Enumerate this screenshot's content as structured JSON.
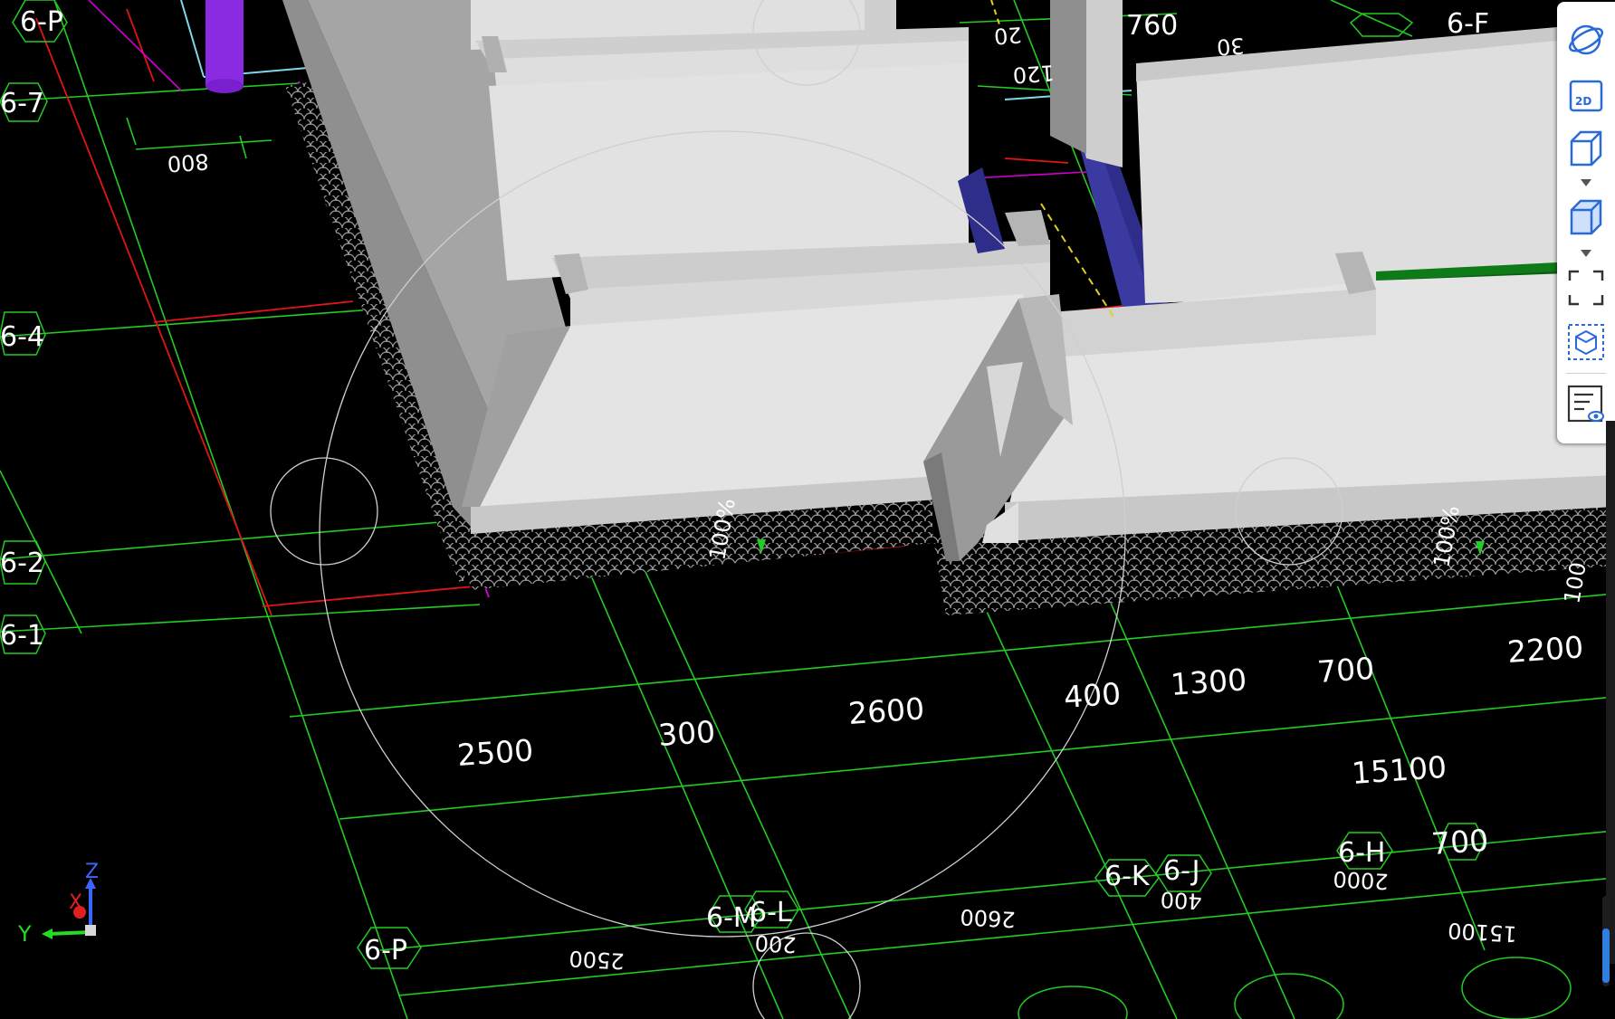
{
  "viewport": {
    "grid_axis_labels": {
      "a_6_P_top": "6-P",
      "a_6_7": "6-7",
      "a_6_4": "6-4",
      "a_6_2": "6-2",
      "a_6_1": "6-1",
      "a_6_F": "6-F",
      "a_6_P_bottom": "6-P",
      "a_6_M": "6-M",
      "a_6_L": "6-L",
      "a_6_K": "6-K",
      "a_6_J": "6-J",
      "a_6_H": "6-H"
    },
    "dimensions": {
      "d_2500": "2500",
      "d_300": "300",
      "d_2600": "2600",
      "d_400": "400",
      "d_1300": "1300",
      "d_700": "700",
      "d_2200": "2200",
      "d_15100": "15100",
      "d_700b": "700",
      "d_800": "800",
      "d_20": "20",
      "d_30": "30",
      "d_120": "120",
      "d_760": "760"
    },
    "mirrored_dimensions": {
      "m_2500": "2500",
      "m_200": "200",
      "m_2600": "2600",
      "m_400": "400",
      "m_2000": "2000",
      "m_15100": "15100"
    },
    "hatch_labels": {
      "h_1": "100%",
      "h_2": "100%",
      "h_3": "100"
    },
    "colors": {
      "grid_green": "#22cc22",
      "axis_red": "#e01515",
      "concrete_light": "#dcdcdc",
      "concrete_mid": "#bdbdbd",
      "concrete_dark": "#8f8f8f",
      "column_purple": "#8a2be2",
      "column_blue": "#2e2e8a",
      "slab_green": "#0a5e12",
      "magenta_line": "#d100d1",
      "cyan_line": "#7fd8e8"
    }
  },
  "axis_indicator": {
    "z": "Z",
    "x": "X",
    "y": "Y"
  },
  "toolbar": {
    "buttons": [
      {
        "name": "orbit",
        "icon": "orbit-icon"
      },
      {
        "name": "view-2d",
        "icon": "view-2d-icon",
        "text": "2D"
      },
      {
        "name": "view-3d-wire",
        "icon": "cube-outline-icon"
      },
      {
        "name": "view-3d-solid",
        "icon": "cube-filled-icon"
      },
      {
        "name": "fullscreen",
        "icon": "fullscreen-icon"
      },
      {
        "name": "display-settings",
        "icon": "cube-frame-icon"
      },
      {
        "name": "properties",
        "icon": "list-eye-icon"
      }
    ]
  }
}
